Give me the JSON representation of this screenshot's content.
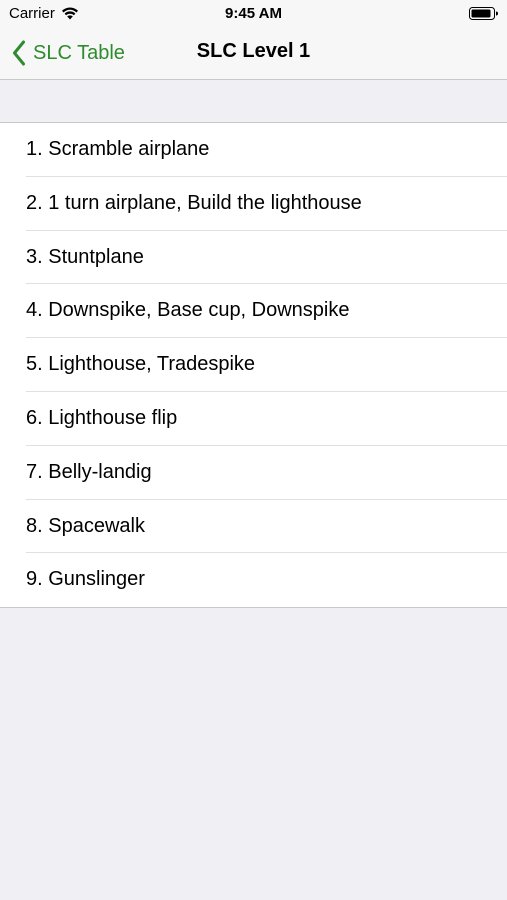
{
  "status_bar": {
    "carrier": "Carrier",
    "time": "9:45 AM",
    "icons": [
      "wifi-icon",
      "battery-icon"
    ]
  },
  "nav": {
    "back_label": "SLC Table",
    "back_icon": "chevron-left-icon",
    "title": "SLC Level 1",
    "tint_color": "#2e8b2e"
  },
  "items": [
    {
      "label": "1. Scramble airplane"
    },
    {
      "label": "2. 1 turn airplane, Build the lighthouse"
    },
    {
      "label": "3. Stuntplane"
    },
    {
      "label": "4. Downspike, Base cup, Downspike"
    },
    {
      "label": "5. Lighthouse, Tradespike"
    },
    {
      "label": "6. Lighthouse flip"
    },
    {
      "label": "7. Belly-landig"
    },
    {
      "label": "8. Spacewalk"
    },
    {
      "label": "9. Gunslinger"
    }
  ]
}
